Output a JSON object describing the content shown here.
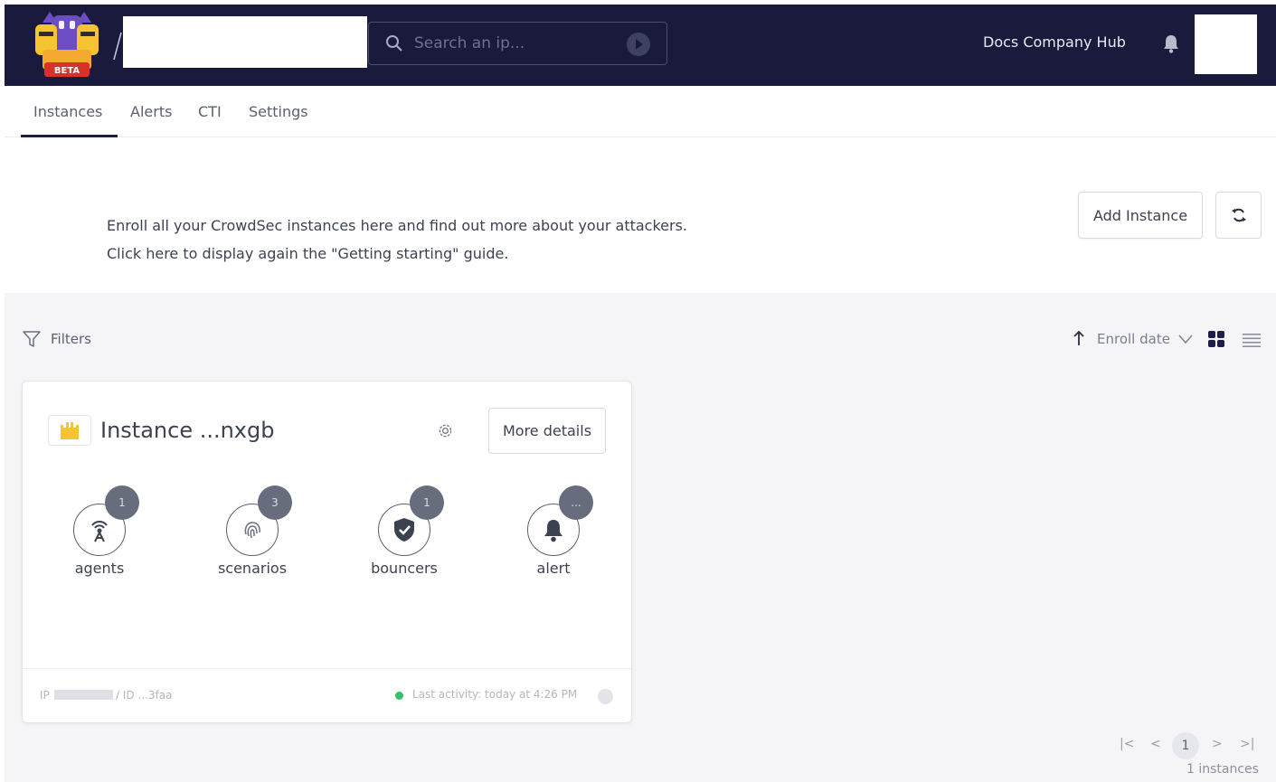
{
  "header": {
    "logo_badge": "BETA",
    "search_placeholder": "Search an ip...",
    "docs_link": "Docs Company Hub"
  },
  "tabs": [
    {
      "label": "Instances",
      "active": true
    },
    {
      "label": "Alerts"
    },
    {
      "label": "CTI"
    },
    {
      "label": "Settings"
    }
  ],
  "intro": {
    "line1": "Enroll all your CrowdSec instances here and find out more about your attackers.",
    "line2": "Click here to display again the \"Getting starting\" guide."
  },
  "actions": {
    "add_instance": "Add Instance"
  },
  "toolbar": {
    "filters_label": "Filters",
    "sort_label": "Enroll date"
  },
  "instance_card": {
    "title": "Instance ...nxgb",
    "more_details": "More details",
    "stats": [
      {
        "label": "agents",
        "count": "1",
        "icon": "antenna-icon"
      },
      {
        "label": "scenarios",
        "count": "3",
        "icon": "fingerprint-icon"
      },
      {
        "label": "bouncers",
        "count": "1",
        "icon": "shield-check-icon"
      },
      {
        "label": "alert",
        "count": "...",
        "icon": "bell-icon"
      }
    ],
    "footer": {
      "ip_label": "IP",
      "id_text": "/ ID ...3faa",
      "last_activity": "Last activity: today at 4:26 PM"
    }
  },
  "pagination": {
    "first": "|<",
    "prev": "<",
    "current": "1",
    "next": ">",
    "last": ">|",
    "count": "1 instances"
  },
  "colors": {
    "header_bg": "#191a3c",
    "accent": "#1d1f4a",
    "status_online": "#33c16a",
    "logo_yellow": "#f6c331",
    "logo_purple": "#6b4fc2",
    "beta_red": "#d6312b"
  }
}
